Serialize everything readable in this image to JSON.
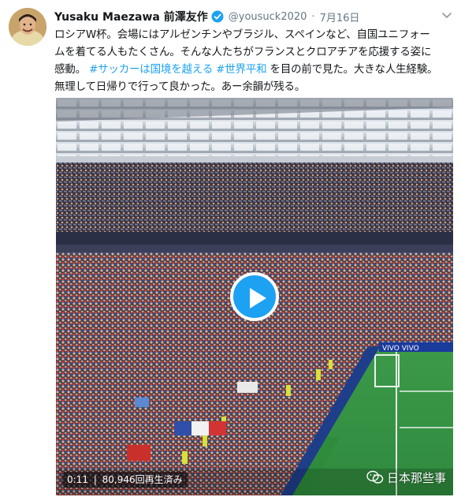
{
  "tweet": {
    "author_name": "Yusaku Maezawa 前澤友作",
    "handle": "@yousuck2020",
    "separator": "·",
    "date": "7月16日",
    "text_lines": [
      [
        {
          "t": "ロシアW杯。会場にはアルゼンチンやブラジル、スペインなど、自国ユニフォー",
          "h": false
        }
      ],
      [
        {
          "t": "ムを着てる人もたくさん。そんな人たちがフランスとクロアチアを応援する姿に",
          "h": false
        }
      ],
      [
        {
          "t": "感動。 ",
          "h": false
        },
        {
          "t": "#サッカーは国境を越える",
          "h": true
        },
        {
          "t": " ",
          "h": false
        },
        {
          "t": "#世界平和",
          "h": true
        },
        {
          "t": " を目の前で見た。大きな人生経験。",
          "h": false
        }
      ],
      [
        {
          "t": "無理して日帰りで行って良かった。あー余韻が残る。",
          "h": false
        }
      ]
    ],
    "video": {
      "duration": "0:11",
      "views": "80,946回再生済み",
      "ad_board_text": "VIVO VIVO"
    }
  },
  "watermark": {
    "text": "日本那些事"
  },
  "colors": {
    "accent": "#1da1f2",
    "text": "#14171a",
    "muted": "#657786"
  }
}
